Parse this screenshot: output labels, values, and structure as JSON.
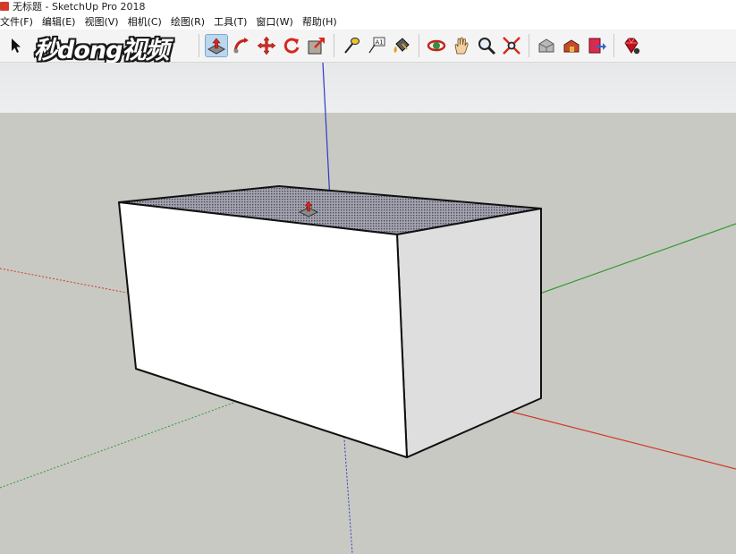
{
  "window": {
    "title": "无标题 - SketchUp Pro 2018"
  },
  "menu": [
    {
      "label": "文件(F)"
    },
    {
      "label": "编辑(E)"
    },
    {
      "label": "视图(V)"
    },
    {
      "label": "相机(C)"
    },
    {
      "label": "绘图(R)"
    },
    {
      "label": "工具(T)"
    },
    {
      "label": "窗口(W)"
    },
    {
      "label": "帮助(H)"
    }
  ],
  "watermark": {
    "text": "秒dong视频"
  },
  "toolbar": {
    "tools": [
      "select",
      "push-pull",
      "follow-me",
      "move",
      "rotate",
      "scale",
      "tape-measure",
      "text",
      "paint-bucket",
      "orbit",
      "pan",
      "zoom",
      "zoom-extents",
      "warehouse",
      "extension",
      "send-to-layout",
      "ruby"
    ],
    "selected_tool": "push-pull"
  },
  "viewport": {
    "colors": {
      "sky": "#e9ebec",
      "ground": "#c9c9c4",
      "face_front": "#ffffff",
      "face_side": "#dcdcdc",
      "face_top_selected": "#8c8c98",
      "axis_red": "#d03a24",
      "axis_green": "#2f9c2f",
      "axis_blue": "#2a3ac8"
    }
  }
}
